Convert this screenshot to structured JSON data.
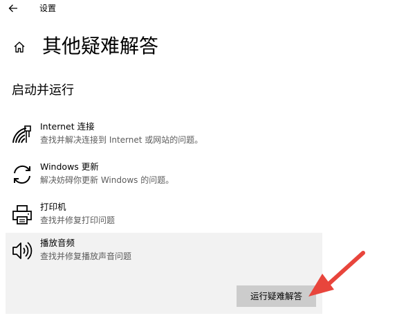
{
  "window": {
    "title": "设置"
  },
  "page": {
    "title": "其他疑难解答"
  },
  "section": {
    "title": "启动并运行"
  },
  "items": [
    {
      "name": "Internet 连接",
      "description": "查找并解决连接到 Internet 或网站的问题。",
      "icon": "wifi-globe-icon"
    },
    {
      "name": "Windows 更新",
      "description": "解决妨碍你更新 Windows 的问题。",
      "icon": "refresh-icon"
    },
    {
      "name": "打印机",
      "description": "查找并修复打印问题",
      "icon": "printer-icon"
    },
    {
      "name": "播放音频",
      "description": "查找并修复播放声音问题",
      "icon": "speaker-icon"
    }
  ],
  "actions": {
    "run_troubleshooter_label": "运行疑难解答"
  },
  "colors": {
    "selected_background": "#f2f2f2",
    "button_background": "#cccccc",
    "annotation_arrow": "#e8453c"
  }
}
